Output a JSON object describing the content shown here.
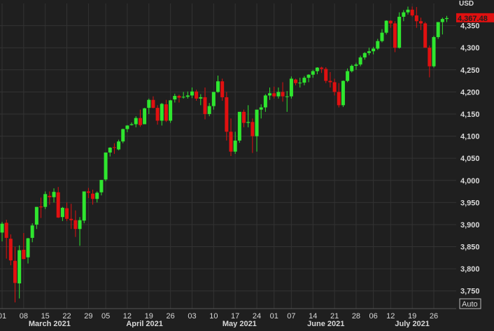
{
  "chart_data": {
    "type": "candlestick",
    "currency_label": "USD",
    "last_price_label": "4,367.48",
    "auto_button_label": "Auto",
    "ylim": [
      3710,
      4400
    ],
    "grid": true,
    "colors": {
      "background": "#1f1f1f",
      "grid": "#333333",
      "up": "#2fe62f",
      "down": "#e01010",
      "axis_text": "#d8d8d8",
      "price_tag": "#e01010"
    },
    "y_ticks": [
      {
        "value": 4350,
        "label": "4,350"
      },
      {
        "value": 4300,
        "label": "4,300"
      },
      {
        "value": 4250,
        "label": "4,250"
      },
      {
        "value": 4200,
        "label": "4,200"
      },
      {
        "value": 4150,
        "label": "4,150"
      },
      {
        "value": 4100,
        "label": "4,100"
      },
      {
        "value": 4050,
        "label": "4,050"
      },
      {
        "value": 4000,
        "label": "4,000"
      },
      {
        "value": 3950,
        "label": "3,950"
      },
      {
        "value": 3900,
        "label": "3,900"
      },
      {
        "value": 3850,
        "label": "3,850"
      },
      {
        "value": 3800,
        "label": "3,800"
      },
      {
        "value": 3750,
        "label": "3,750"
      }
    ],
    "x_ticks": [
      {
        "index": 0,
        "label": "01"
      },
      {
        "index": 5,
        "label": "08"
      },
      {
        "index": 10,
        "label": "15"
      },
      {
        "index": 15,
        "label": "22"
      },
      {
        "index": 20,
        "label": "29"
      },
      {
        "index": 24,
        "label": "05"
      },
      {
        "index": 29,
        "label": "12"
      },
      {
        "index": 34,
        "label": "19"
      },
      {
        "index": 39,
        "label": "26"
      },
      {
        "index": 44,
        "label": "03"
      },
      {
        "index": 49,
        "label": "10"
      },
      {
        "index": 54,
        "label": "17"
      },
      {
        "index": 59,
        "label": "24"
      },
      {
        "index": 63,
        "label": "01"
      },
      {
        "index": 67,
        "label": "07"
      },
      {
        "index": 72,
        "label": "14"
      },
      {
        "index": 77,
        "label": "21"
      },
      {
        "index": 82,
        "label": "28"
      },
      {
        "index": 86,
        "label": "06"
      },
      {
        "index": 90,
        "label": "12"
      },
      {
        "index": 95,
        "label": "19"
      },
      {
        "index": 100,
        "label": "26"
      }
    ],
    "month_labels": [
      {
        "index": 11,
        "label": "March 2021"
      },
      {
        "index": 33,
        "label": "April 2021"
      },
      {
        "index": 55,
        "label": "May 2021"
      },
      {
        "index": 75,
        "label": "June 2021"
      },
      {
        "index": 95,
        "label": "July 2021"
      }
    ],
    "ohlc": [
      [
        3882,
        3906,
        3862,
        3902
      ],
      [
        3904,
        3911,
        3823,
        3870
      ],
      [
        3868,
        3878,
        3808,
        3819
      ],
      [
        3818,
        3850,
        3724,
        3768
      ],
      [
        3767,
        3853,
        3733,
        3842
      ],
      [
        3843,
        3881,
        3822,
        3822
      ],
      [
        3826,
        3870,
        3812,
        3869
      ],
      [
        3870,
        3903,
        3860,
        3898
      ],
      [
        3900,
        3940,
        3890,
        3940
      ],
      [
        3941,
        3961,
        3915,
        3939
      ],
      [
        3940,
        3975,
        3935,
        3969
      ],
      [
        3965,
        3975,
        3945,
        3962
      ],
      [
        3962,
        3982,
        3950,
        3974
      ],
      [
        3973,
        3985,
        3915,
        3916
      ],
      [
        3917,
        3940,
        3908,
        3938
      ],
      [
        3937,
        3950,
        3908,
        3913
      ],
      [
        3913,
        3947,
        3890,
        3910
      ],
      [
        3910,
        3932,
        3872,
        3890
      ],
      [
        3890,
        3917,
        3852,
        3910
      ],
      [
        3909,
        3972,
        3903,
        3975
      ],
      [
        3975,
        3983,
        3960,
        3972
      ],
      [
        3970,
        3979,
        3945,
        3958
      ],
      [
        3958,
        3975,
        3950,
        3972
      ],
      [
        3973,
        4001,
        3966,
        4001
      ],
      [
        4002,
        4063,
        3998,
        4063
      ],
      [
        4063,
        4075,
        4054,
        4074
      ],
      [
        4075,
        4084,
        4060,
        4074
      ],
      [
        4070,
        4092,
        4068,
        4088
      ],
      [
        4088,
        4117,
        4084,
        4116
      ],
      [
        4116,
        4125,
        4109,
        4124
      ],
      [
        4125,
        4131,
        4124,
        4127
      ],
      [
        4127,
        4145,
        4120,
        4141
      ],
      [
        4141,
        4160,
        4121,
        4125
      ],
      [
        4127,
        4164,
        4127,
        4163
      ],
      [
        4164,
        4185,
        4150,
        4182
      ],
      [
        4182,
        4190,
        4163,
        4164
      ],
      [
        4164,
        4170,
        4126,
        4135
      ],
      [
        4135,
        4175,
        4124,
        4173
      ],
      [
        4172,
        4182,
        4132,
        4135
      ],
      [
        4135,
        4182,
        4130,
        4181
      ],
      [
        4183,
        4196,
        4176,
        4191
      ],
      [
        4191,
        4194,
        4176,
        4187
      ],
      [
        4189,
        4200,
        4185,
        4189
      ],
      [
        4189,
        4201,
        4185,
        4192
      ],
      [
        4192,
        4210,
        4186,
        4201
      ],
      [
        4201,
        4205,
        4180,
        4185
      ],
      [
        4185,
        4195,
        4170,
        4188
      ],
      [
        4188,
        4210,
        4138,
        4150
      ],
      [
        4150,
        4175,
        4145,
        4168
      ],
      [
        4168,
        4200,
        4160,
        4200
      ],
      [
        4200,
        4237,
        4198,
        4224
      ],
      [
        4224,
        4230,
        4180,
        4188
      ],
      [
        4188,
        4200,
        4090,
        4110
      ],
      [
        4110,
        4140,
        4055,
        4065
      ],
      [
        4065,
        4110,
        4060,
        4090
      ],
      [
        4090,
        4150,
        4085,
        4155
      ],
      [
        4155,
        4160,
        4120,
        4130
      ],
      [
        4130,
        4170,
        4120,
        4132
      ],
      [
        4132,
        4140,
        4062,
        4100
      ],
      [
        4100,
        4150,
        4065,
        4160
      ],
      [
        4160,
        4172,
        4140,
        4165
      ],
      [
        4165,
        4195,
        4155,
        4192
      ],
      [
        4192,
        4210,
        4182,
        4197
      ],
      [
        4197,
        4212,
        4185,
        4190
      ],
      [
        4190,
        4210,
        4185,
        4200
      ],
      [
        4200,
        4222,
        4178,
        4190
      ],
      [
        4190,
        4202,
        4155,
        4190
      ],
      [
        4190,
        4235,
        4185,
        4230
      ],
      [
        4228,
        4230,
        4215,
        4220
      ],
      [
        4220,
        4232,
        4210,
        4221
      ],
      [
        4221,
        4236,
        4215,
        4232
      ],
      [
        4232,
        4240,
        4222,
        4239
      ],
      [
        4239,
        4250,
        4232,
        4247
      ],
      [
        4247,
        4256,
        4240,
        4255
      ],
      [
        4255,
        4257,
        4243,
        4252
      ],
      [
        4252,
        4256,
        4220,
        4225
      ],
      [
        4225,
        4245,
        4210,
        4222
      ],
      [
        4222,
        4230,
        4192,
        4200
      ],
      [
        4200,
        4220,
        4165,
        4170
      ],
      [
        4170,
        4226,
        4166,
        4225
      ],
      [
        4225,
        4253,
        4222,
        4247
      ],
      [
        4247,
        4262,
        4244,
        4259
      ],
      [
        4259,
        4266,
        4250,
        4262
      ],
      [
        4262,
        4282,
        4258,
        4278
      ],
      [
        4278,
        4290,
        4273,
        4288
      ],
      [
        4288,
        4300,
        4283,
        4292
      ],
      [
        4292,
        4302,
        4285,
        4298
      ],
      [
        4298,
        4320,
        4295,
        4315
      ],
      [
        4315,
        4342,
        4312,
        4334
      ],
      [
        4334,
        4362,
        4330,
        4361
      ],
      [
        4361,
        4362,
        4345,
        4355
      ],
      [
        4355,
        4360,
        4290,
        4300
      ],
      [
        4300,
        4380,
        4298,
        4370
      ],
      [
        4370,
        4385,
        4360,
        4380
      ],
      [
        4380,
        4393,
        4375,
        4386
      ],
      [
        4386,
        4393,
        4370,
        4373
      ],
      [
        4373,
        4392,
        4345,
        4360
      ],
      [
        4360,
        4368,
        4340,
        4355
      ],
      [
        4355,
        4358,
        4310,
        4300
      ],
      [
        4300,
        4305,
        4233,
        4258
      ],
      [
        4258,
        4327,
        4255,
        4324
      ],
      [
        4324,
        4358,
        4320,
        4358
      ],
      [
        4358,
        4368,
        4330,
        4365
      ],
      [
        4365,
        4372,
        4358,
        4367
      ]
    ]
  }
}
